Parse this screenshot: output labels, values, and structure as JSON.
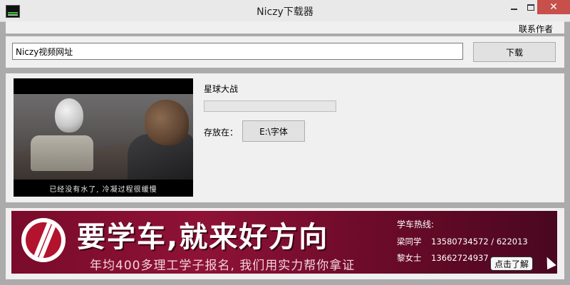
{
  "window": {
    "title": "Niczy下载器",
    "controls": {
      "minimize_icon": "minimize-icon",
      "maximize_icon": "maximize-icon",
      "close_icon": "close-icon",
      "close_glyph": "✕"
    }
  },
  "menubar": {
    "items": [
      {
        "label": "联系作者"
      }
    ]
  },
  "url_bar": {
    "input_value": "Niczy视频网址",
    "download_label": "下载"
  },
  "video": {
    "title": "星球大战",
    "subtitle": "已经没有水了, 冷凝过程很缓慢",
    "progress": 0,
    "save_label": "存放在：",
    "save_path": "E:\\字体"
  },
  "ad": {
    "headline": "要学车,就来好方向",
    "sub": "年均400多理工学子报名, 我们用实力帮你拿证",
    "hotline_title": "学车热线:",
    "contacts": [
      {
        "name": "梁同学",
        "phone": "13580734572 / 622013"
      },
      {
        "name": "黎女士",
        "phone": "13662724937"
      }
    ],
    "cta": "点击了解"
  },
  "colors": {
    "progress_fill": "#06b025",
    "ad_background": "#8e1236",
    "close_button": "#c7504b"
  }
}
